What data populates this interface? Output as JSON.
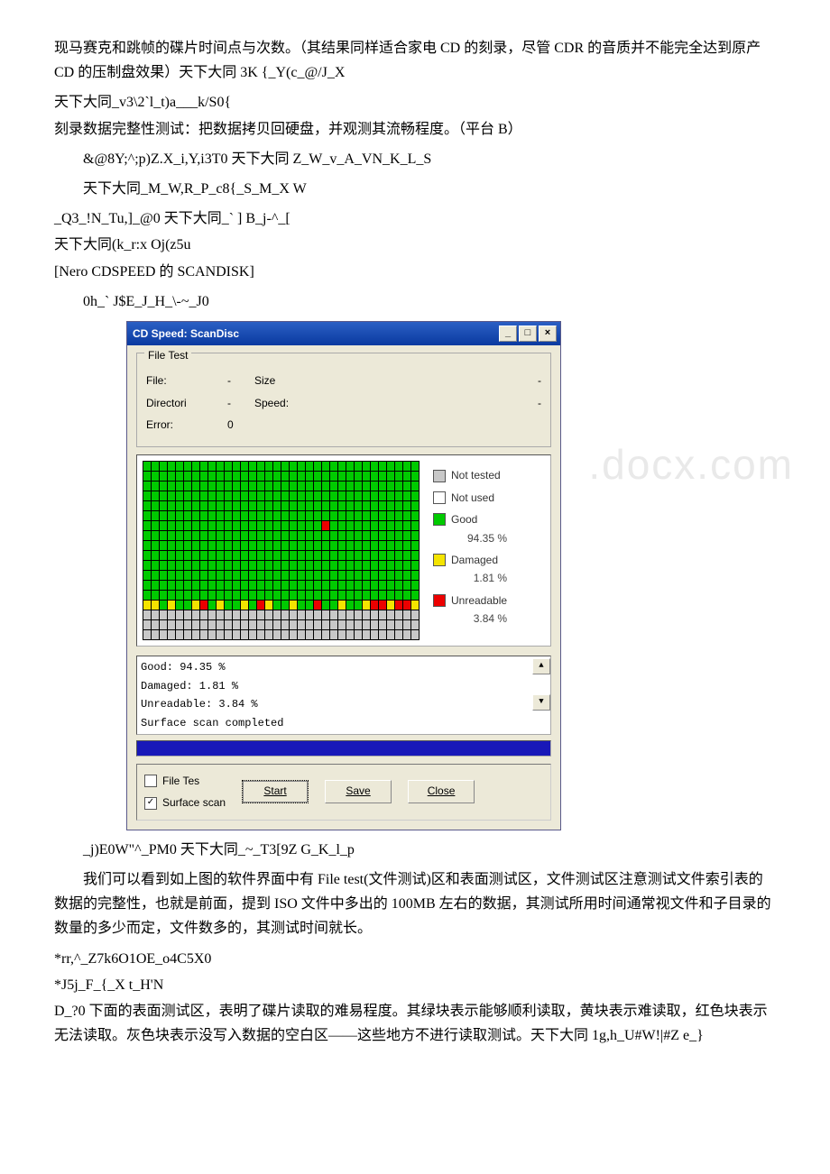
{
  "para": {
    "p1": "现马赛克和跳帧的碟片时间点与次数。（其结果同样适合家电 CD 的刻录，尽管 CDR 的音质并不能完全达到原产 CD 的压制盘效果）天下大同 3K {_Y(c_@/J_X",
    "p2": "天下大同_v3\\2`l_t)a___k/S0{",
    "p3": "刻录数据完整性测试：把数据拷贝回硬盘，并观测其流畅程度。（平台 B）",
    "p4": "&@8Y;^;p)Z.X_i,Y,i3T0 天下大同 Z_W_v_A_VN_K_L_S",
    "p5": "天下大同_M_W,R_P_c8{_S_M_X W",
    "p6": "_Q3_!N_Tu,]_@0 天下大同_` ] B_j-^_[",
    "p7": "天下大同(k_r:x Oj(z5u",
    "p8": "[Nero CDSPEED 的 SCANDISK]",
    "p9": "0h_` J$E_J_H_\\-~_J0",
    "p10": "_j)E0W\"^_PM0 天下大同_~_T3[9Z G_K_l_p",
    "p11": "　　我们可以看到如上图的软件界面中有 File test(文件测试)区和表面测试区，文件测试区注意测试文件索引表的数据的完整性，也就是前面，提到 ISO 文件中多出的 100MB 左右的数据，其测试所用时间通常视文件和子目录的数量的多少而定，文件数多的，其测试时间就长。",
    "p12": "*rr,^_Z7k6O1OE_o4C5X0",
    "p13": "*J5j_F_{_X t_H'N",
    "p14": "D_?0 下面的表面测试区，表明了碟片读取的难易程度。其绿块表示能够顺利读取，黄块表示难读取，红色块表示无法读取。灰色块表示没写入数据的空白区——这些地方不进行读取测试。天下大同 1g,h_U#W!|#Z e_}"
  },
  "win": {
    "title": "CD Speed: ScanDisc",
    "controls": {
      "min": "_",
      "max": "□",
      "close": "×"
    },
    "group_label": "File Test",
    "ft": {
      "file_lbl": "File:",
      "size_lbl": "Size",
      "dir_lbl": "Directori",
      "speed_lbl": "Speed:",
      "err_lbl": "Error:",
      "err_val": "0",
      "dash": "-"
    },
    "legend": {
      "nt": "Not tested",
      "nu": "Not used",
      "good": "Good",
      "good_pct": "94.35 %",
      "dam": "Damaged",
      "dam_pct": "1.81 %",
      "unr": "Unreadable",
      "unr_pct": "3.84 %"
    },
    "log": {
      "l1": "Good: 94.35 %",
      "l2": "Damaged:  1.81 %",
      "l3": "Unreadable:  3.84 %",
      "l4": "Surface scan completed"
    },
    "buttons": {
      "file_test": "File Tes",
      "surface": "Surface scan",
      "start": "Start",
      "save": "Save",
      "close": "Close"
    }
  },
  "watermark": ".docx.com",
  "chart_data": {
    "type": "heatmap",
    "title": "ScanDisc surface map",
    "categories": [
      "Good",
      "Damaged",
      "Unreadable",
      "Not tested",
      "Not used"
    ],
    "percentages": {
      "Good": 94.35,
      "Damaged": 1.81,
      "Unreadable": 3.84
    },
    "grid": {
      "cols": 34,
      "rows": 18,
      "note": "approx 14 rows Good with a single Unreadable cell mid-grid; 1 row mixed Damaged/Unreadable/Good; 3 rows Not tested (grey)"
    }
  }
}
